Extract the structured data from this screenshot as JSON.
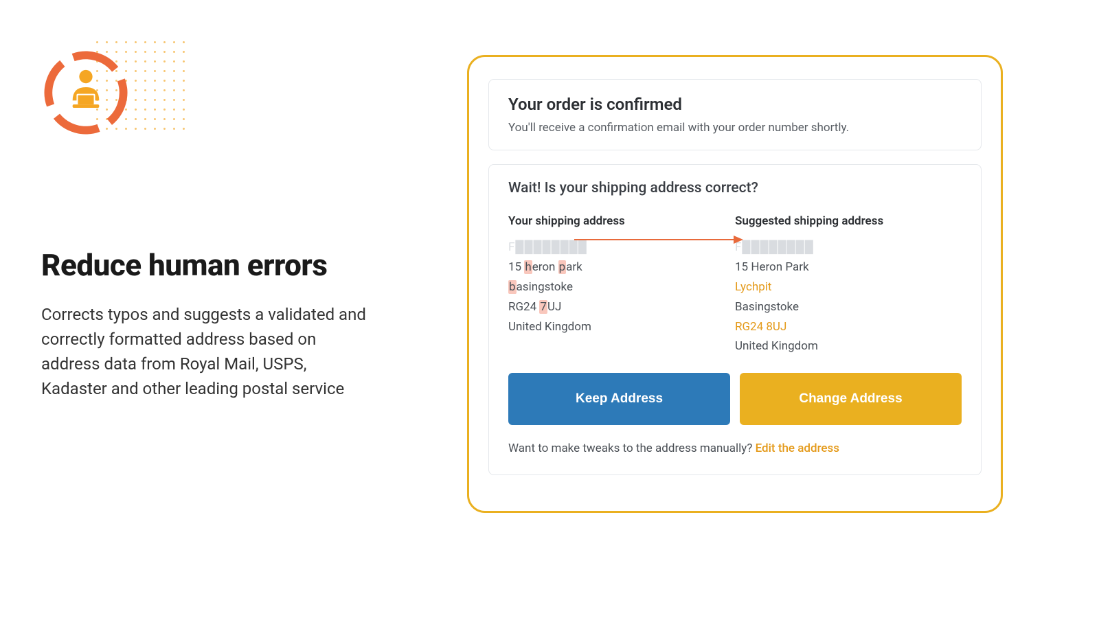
{
  "feature": {
    "title": "Reduce human errors",
    "desc": "Corrects typos and suggests a validated and correctly formatted address based on address data from Royal Mail, USPS, Kadaster and other leading postal service"
  },
  "dialog": {
    "confirm_title": "Your order is confirmed",
    "confirm_sub": "You'll receive a confirmation email with your order number shortly.",
    "prompt_title": "Wait! Is your shipping address correct?",
    "left_col_header": "Your shipping address",
    "right_col_header": "Suggested shipping address",
    "keep_label": "Keep Address",
    "change_label": "Change Address",
    "manual_prefix": "Want to make tweaks to the address manually? ",
    "manual_link": "Edit the address"
  },
  "entered_address": {
    "name_blurred": "F████████",
    "line2_pre": "15 ",
    "line2_err1": "h",
    "line2_mid": "eron ",
    "line2_err2": "p",
    "line2_post": "ark",
    "line3_err": "b",
    "line3_post": "asingstoke",
    "line4_pre": "RG24 ",
    "line4_err": "7",
    "line4_post": "UJ",
    "line5": "United Kingdom"
  },
  "suggested_address": {
    "name_blurred": "F████████",
    "line2": "15 Heron Park",
    "line3": "Lychpit",
    "line4": "Basingstoke",
    "line5": "RG24 8UJ",
    "line6": "United Kingdom"
  }
}
